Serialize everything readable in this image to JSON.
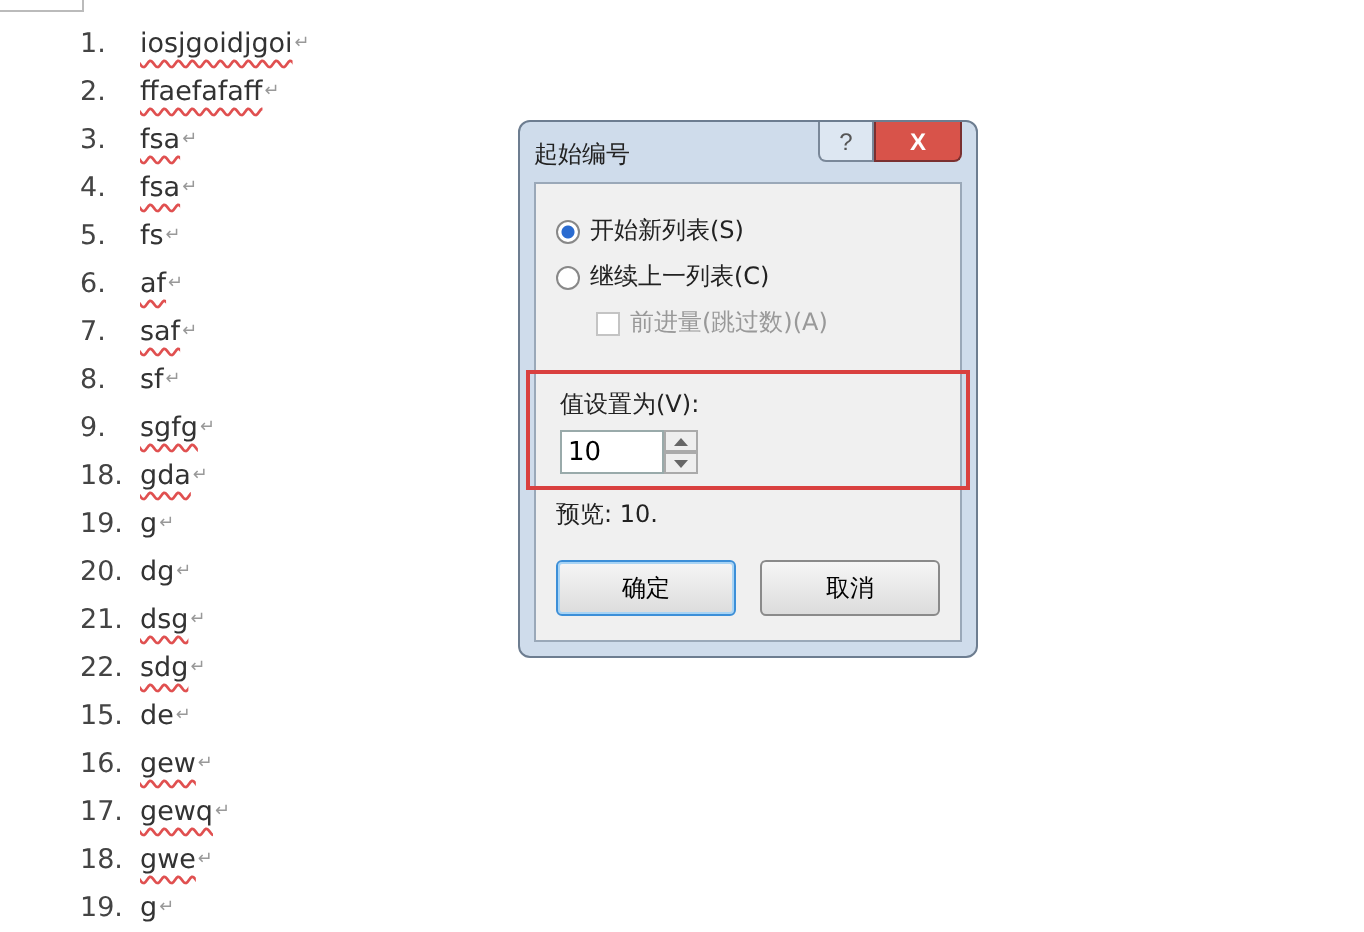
{
  "document": {
    "items": [
      {
        "number": "1.",
        "text": "iosjgoidjgoi",
        "misspelled": true,
        "mark": "↵"
      },
      {
        "number": "2.",
        "text": "ffaefafaff",
        "misspelled": true,
        "mark": "↵"
      },
      {
        "number": "3.",
        "text": "fsa",
        "misspelled": true,
        "mark": "↵"
      },
      {
        "number": "4.",
        "text": "fsa",
        "misspelled": true,
        "mark": "↵"
      },
      {
        "number": "5.",
        "text": "fs",
        "misspelled": false,
        "mark": "↵"
      },
      {
        "number": "6.",
        "text": "af",
        "misspelled": true,
        "mark": "↵"
      },
      {
        "number": "7.",
        "text": "saf",
        "misspelled": true,
        "mark": "↵"
      },
      {
        "number": "8.",
        "text": "sf",
        "misspelled": false,
        "mark": "↵"
      },
      {
        "number": "9.",
        "text": "sgfg",
        "misspelled": true,
        "mark": "↵"
      },
      {
        "number": "18.",
        "text": "gda",
        "misspelled": true,
        "mark": "↵"
      },
      {
        "number": "19.",
        "text": "g",
        "misspelled": false,
        "mark": "↵"
      },
      {
        "number": "20.",
        "text": "dg",
        "misspelled": false,
        "mark": "↵"
      },
      {
        "number": "21.",
        "text": "dsg",
        "misspelled": true,
        "mark": "↵"
      },
      {
        "number": "22.",
        "text": "sdg",
        "misspelled": true,
        "mark": "↵"
      },
      {
        "number": "15.",
        "text": "de",
        "misspelled": false,
        "mark": "↵"
      },
      {
        "number": "16.",
        "text": "gew",
        "misspelled": true,
        "mark": "↵"
      },
      {
        "number": "17.",
        "text": "gewq",
        "misspelled": true,
        "mark": "↵"
      },
      {
        "number": "18.",
        "text": "gwe",
        "misspelled": true,
        "mark": "↵"
      },
      {
        "number": "19.",
        "text": "g",
        "misspelled": false,
        "mark": "↵"
      }
    ]
  },
  "dialog": {
    "title": "起始编号",
    "help": "?",
    "close": "X",
    "options": [
      {
        "kind": "radio",
        "label": "开始新列表(S)",
        "selected": true,
        "disabled": false
      },
      {
        "kind": "radio",
        "label": "继续上一列表(C)",
        "selected": false,
        "disabled": false
      },
      {
        "kind": "checkbox",
        "label": "前进量(跳过数)(A)",
        "checked": false,
        "disabled": true
      }
    ],
    "value_label": "值设置为(V):",
    "value": "10",
    "highlighted": true,
    "preview": "预览: 10.",
    "buttons": [
      {
        "label": "确定",
        "default": true
      },
      {
        "label": "取消",
        "default": false
      }
    ]
  }
}
